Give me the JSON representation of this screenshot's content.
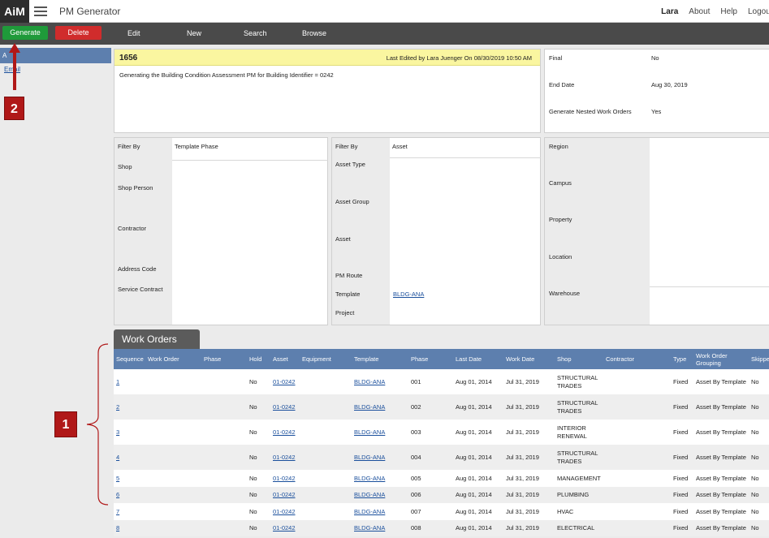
{
  "topbar": {
    "logo": "AiM",
    "app_title": "PM Generator",
    "user": "Lara",
    "about": "About",
    "help": "Help",
    "logout": "Logout"
  },
  "toolbar": {
    "generate": "Generate",
    "delete": "Delete",
    "edit": "Edit",
    "new": "New",
    "search": "Search",
    "browse": "Browse"
  },
  "sidebar": {
    "header": "A",
    "link": "Email"
  },
  "header_panel": {
    "id": "1656",
    "last_edited": "Last Edited by Lara Juenger On 08/30/2019 10:50 AM",
    "description": "Generating the Building Condition Assessment PM for Building Identifier = 0242"
  },
  "info_panel": {
    "final_label": "Final",
    "final_value": "No",
    "end_date_label": "End Date",
    "end_date_value": "Aug 30, 2019",
    "nested_label": "Generate Nested Work Orders",
    "nested_value": "Yes"
  },
  "filter1": {
    "filter_by_label": "Filter By",
    "filter_by_value": "Template Phase",
    "shop": "Shop",
    "shop_person": "Shop Person",
    "contractor": "Contractor",
    "address_code": "Address Code",
    "service_contract": "Service Contract"
  },
  "filter2": {
    "filter_by_label": "Filter By",
    "filter_by_value": "Asset",
    "asset_type": "Asset Type",
    "asset_group": "Asset Group",
    "asset": "Asset",
    "pm_route": "PM Route",
    "template": "Template",
    "template_value": "BLDG-ANA",
    "project": "Project"
  },
  "filter3": {
    "region": "Region",
    "campus": "Campus",
    "property": "Property",
    "location": "Location",
    "warehouse": "Warehouse"
  },
  "work_orders": {
    "tab": "Work Orders",
    "columns": [
      "Sequence",
      "Work Order",
      "Phase",
      "Hold",
      "Asset",
      "Equipment",
      "Template",
      "Phase",
      "Last Date",
      "Work Date",
      "Shop",
      "Contractor",
      "Type",
      "Work Order Grouping",
      "Skipped"
    ],
    "rows": [
      {
        "seq": "1",
        "hold": "No",
        "asset": "01-0242",
        "template": "BLDG-ANA",
        "phase": "001",
        "last_date": "Aug 01, 2014",
        "work_date": "Jul 31, 2019",
        "shop_line1": "STRUCTURAL",
        "shop_line2": "TRADES",
        "type": "Fixed",
        "grouping": "Asset By Template",
        "skipped": "No"
      },
      {
        "seq": "2",
        "hold": "No",
        "asset": "01-0242",
        "template": "BLDG-ANA",
        "phase": "002",
        "last_date": "Aug 01, 2014",
        "work_date": "Jul 31, 2019",
        "shop_line1": "STRUCTURAL",
        "shop_line2": "TRADES",
        "type": "Fixed",
        "grouping": "Asset By Template",
        "skipped": "No"
      },
      {
        "seq": "3",
        "hold": "No",
        "asset": "01-0242",
        "template": "BLDG-ANA",
        "phase": "003",
        "last_date": "Aug 01, 2014",
        "work_date": "Jul 31, 2019",
        "shop_line1": "INTERIOR",
        "shop_line2": "RENEWAL",
        "type": "Fixed",
        "grouping": "Asset By Template",
        "skipped": "No"
      },
      {
        "seq": "4",
        "hold": "No",
        "asset": "01-0242",
        "template": "BLDG-ANA",
        "phase": "004",
        "last_date": "Aug 01, 2014",
        "work_date": "Jul 31, 2019",
        "shop_line1": "STRUCTURAL",
        "shop_line2": "TRADES",
        "type": "Fixed",
        "grouping": "Asset By Template",
        "skipped": "No"
      },
      {
        "seq": "5",
        "hold": "No",
        "asset": "01-0242",
        "template": "BLDG-ANA",
        "phase": "005",
        "last_date": "Aug 01, 2014",
        "work_date": "Jul 31, 2019",
        "shop_line1": "MANAGEMENT",
        "shop_line2": "",
        "type": "Fixed",
        "grouping": "Asset By Template",
        "skipped": "No"
      },
      {
        "seq": "6",
        "hold": "No",
        "asset": "01-0242",
        "template": "BLDG-ANA",
        "phase": "006",
        "last_date": "Aug 01, 2014",
        "work_date": "Jul 31, 2019",
        "shop_line1": "PLUMBING",
        "shop_line2": "",
        "type": "Fixed",
        "grouping": "Asset By Template",
        "skipped": "No"
      },
      {
        "seq": "7",
        "hold": "No",
        "asset": "01-0242",
        "template": "BLDG-ANA",
        "phase": "007",
        "last_date": "Aug 01, 2014",
        "work_date": "Jul 31, 2019",
        "shop_line1": "HVAC",
        "shop_line2": "",
        "type": "Fixed",
        "grouping": "Asset By Template",
        "skipped": "No"
      },
      {
        "seq": "8",
        "hold": "No",
        "asset": "01-0242",
        "template": "BLDG-ANA",
        "phase": "008",
        "last_date": "Aug 01, 2014",
        "work_date": "Jul 31, 2019",
        "shop_line1": "ELECTRICAL",
        "shop_line2": "",
        "type": "Fixed",
        "grouping": "Asset By Template",
        "skipped": "No"
      }
    ]
  },
  "annotations": {
    "marker_1": "1",
    "marker_2": "2"
  },
  "colors": {
    "toolbar": "#4a4a4a",
    "generate": "#1f9a3a",
    "delete": "#d02c2c",
    "table_header": "#5d7fae",
    "highlight": "#faf6a0",
    "annotation": "#b01818"
  }
}
